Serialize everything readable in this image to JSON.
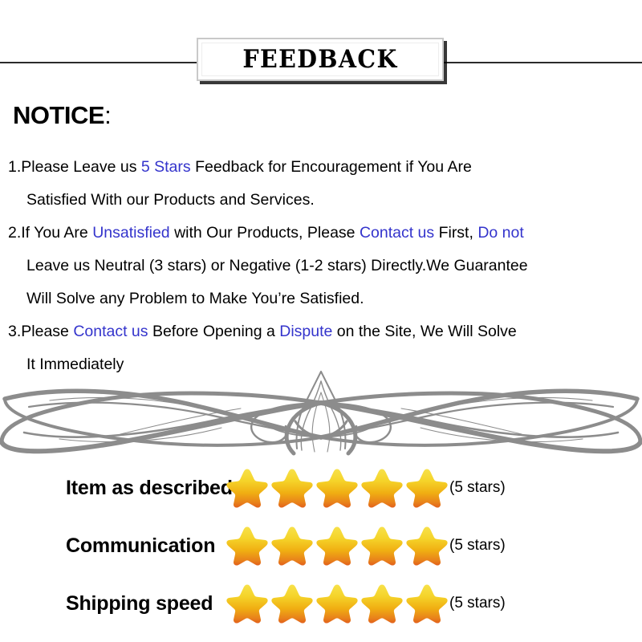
{
  "banner": {
    "title": "FEEDBACK"
  },
  "notice": {
    "heading": "NOTICE",
    "heading_colon": ":",
    "items": [
      {
        "lines": [
          [
            {
              "text": "1.Please Leave us  ",
              "highlight": false
            },
            {
              "text": "5 Stars",
              "highlight": true
            },
            {
              "text": "  Feedback for  Encouragement  if You Are",
              "highlight": false
            }
          ],
          [
            {
              "text": "Satisfied With our Products and Services.",
              "highlight": false
            }
          ]
        ]
      },
      {
        "lines": [
          [
            {
              "text": "2.If You Are ",
              "highlight": false
            },
            {
              "text": "Unsatisfied",
              "highlight": true
            },
            {
              "text": " with Our Products, Please ",
              "highlight": false
            },
            {
              "text": "Contact us",
              "highlight": true
            },
            {
              "text": " First, ",
              "highlight": false
            },
            {
              "text": "Do not",
              "highlight": true
            }
          ],
          [
            {
              "text": "Leave us Neutral (3 stars) or Negative (1-2 stars) Directly.We Guarantee",
              "highlight": false
            }
          ],
          [
            {
              "text": "Will Solve any Problem to Make You’re  Satisfied.",
              "highlight": false
            }
          ]
        ]
      },
      {
        "lines": [
          [
            {
              "text": "3.Please ",
              "highlight": false
            },
            {
              "text": "Contact us",
              "highlight": true
            },
            {
              "text": " Before Opening a ",
              "highlight": false
            },
            {
              "text": "Dispute",
              "highlight": true
            },
            {
              "text": " on the Site, We Will Solve",
              "highlight": false
            }
          ],
          [
            {
              "text": "It Immediately",
              "highlight": false
            }
          ]
        ]
      }
    ],
    "highlight_color": "#3434CC"
  },
  "ratings": {
    "star_count": 5,
    "star_colors": {
      "top": "#F5D82A",
      "mid": "#F2B313",
      "bottom": "#E8731A",
      "shadow": "#E25A1C"
    },
    "rows": [
      {
        "label": "Item as described",
        "stars": 5,
        "note": "(5 stars)"
      },
      {
        "label": "Communication",
        "stars": 5,
        "note": "(5 stars)"
      },
      {
        "label": "Shipping speed",
        "stars": 5,
        "note": "(5 stars)"
      }
    ]
  },
  "ornament": {
    "color": "#8C8C8C",
    "name": "symmetric-filigree-flourish"
  }
}
